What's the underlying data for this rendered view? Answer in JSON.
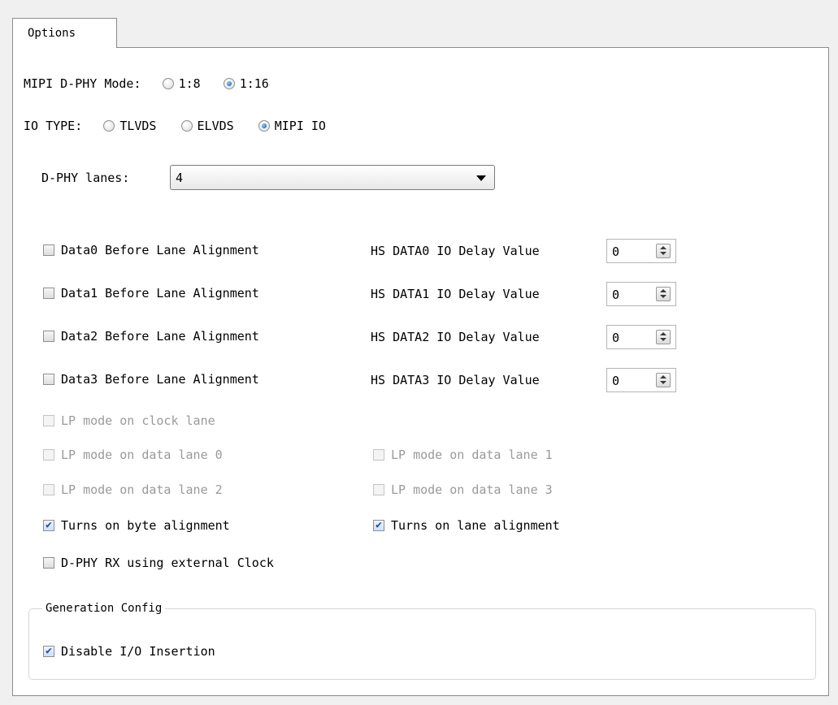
{
  "tab": {
    "label": "Options"
  },
  "mipi_mode": {
    "label": "MIPI D-PHY Mode:",
    "options": [
      "1:8",
      "1:16"
    ],
    "selected": "1:16"
  },
  "io_type": {
    "label": "IO TYPE:",
    "options": [
      "TLVDS",
      "ELVDS",
      "MIPI IO"
    ],
    "selected": "MIPI IO"
  },
  "dphy_lanes": {
    "label": "D-PHY lanes:",
    "value": "4"
  },
  "lanes": [
    {
      "align_label": "Data0 Before Lane Alignment",
      "delay_label": "HS DATA0 IO Delay Value",
      "delay_value": "0",
      "checked": false
    },
    {
      "align_label": "Data1 Before Lane Alignment",
      "delay_label": "HS DATA1 IO Delay Value",
      "delay_value": "0",
      "checked": false
    },
    {
      "align_label": "Data2 Before Lane Alignment",
      "delay_label": "HS DATA2 IO Delay Value",
      "delay_value": "0",
      "checked": false
    },
    {
      "align_label": "Data3 Before Lane Alignment",
      "delay_label": "HS DATA3 IO Delay Value",
      "delay_value": "0",
      "checked": false
    }
  ],
  "lp_mode": {
    "clock_lane": "LP mode on clock lane",
    "data_lane_0": "LP mode on data lane 0",
    "data_lane_1": "LP mode on data lane 1",
    "data_lane_2": "LP mode on data lane 2",
    "data_lane_3": "LP mode on data lane 3"
  },
  "byte_alignment": {
    "label": "Turns on byte alignment",
    "checked": true
  },
  "lane_alignment": {
    "label": "Turns on lane alignment",
    "checked": true
  },
  "external_clock": {
    "label": "D-PHY RX using external Clock",
    "checked": false
  },
  "generation_config": {
    "title": "Generation Config",
    "disable_io_insertion": {
      "label": "Disable I/O Insertion",
      "checked": true
    }
  },
  "icons": {
    "checkmark": "✔",
    "dropdown": "chevron-down-icon",
    "spinner": "spinner-arrows-icon"
  }
}
